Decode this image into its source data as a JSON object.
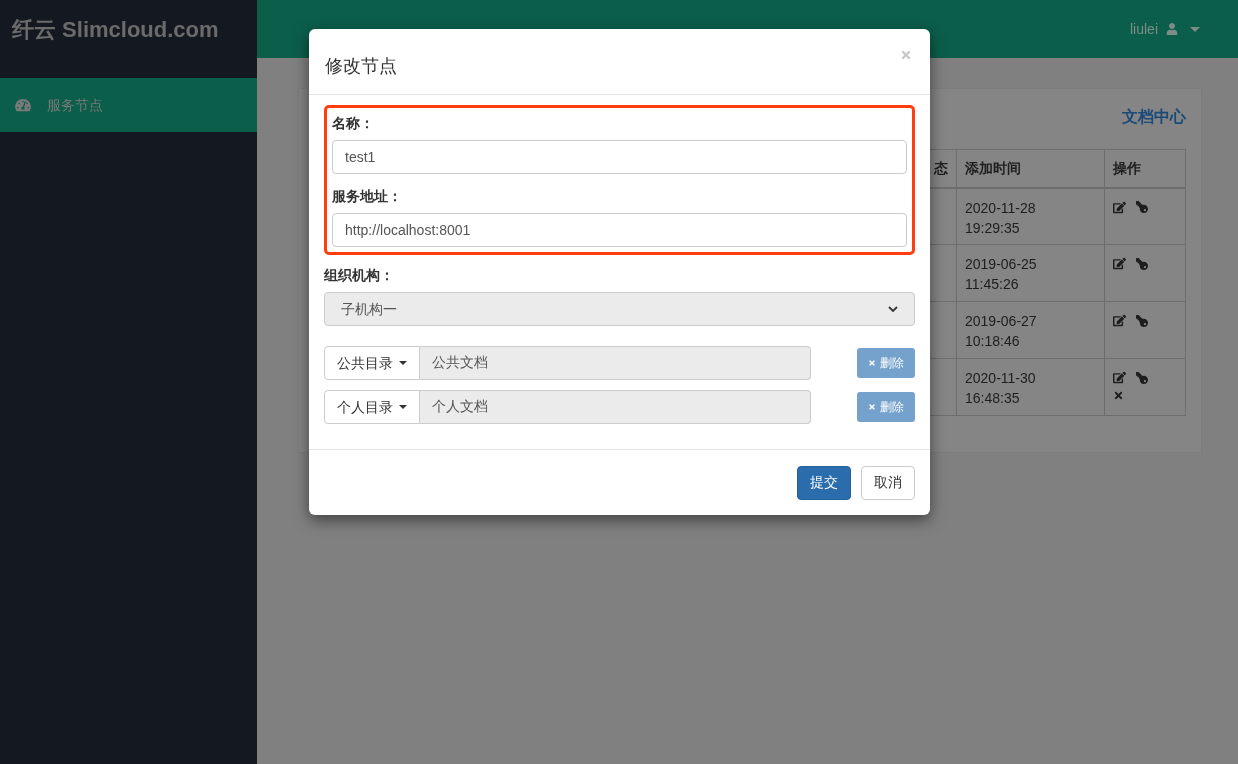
{
  "brand": "纤云 Slimcloud.com",
  "sidebar": {
    "items": [
      {
        "label": "服务节点",
        "selected": true
      }
    ]
  },
  "topbar": {
    "user": "liulei"
  },
  "panel": {
    "link": "文档中心",
    "table": {
      "columns": [
        "态",
        "添加时间",
        "操作"
      ],
      "rows": [
        {
          "time": [
            "2020-11-28",
            "19:29:35"
          ],
          "deletable": false
        },
        {
          "time": [
            "2019-06-25",
            "11:45:26"
          ],
          "deletable": false
        },
        {
          "time": [
            "2019-06-27",
            "10:18:46"
          ],
          "deletable": false
        },
        {
          "time": [
            "2020-11-30",
            "16:48:35"
          ],
          "deletable": true
        }
      ]
    }
  },
  "dialog": {
    "title": "修改节点",
    "fields": [
      {
        "label": "名称：",
        "value": "test1"
      },
      {
        "label": "服务地址：",
        "value": "http://localhost:8001"
      }
    ],
    "org": {
      "label": "组织机构：",
      "value": "子机构一"
    },
    "dirs": [
      {
        "type": "公共目录",
        "value": "公共文档",
        "button": "删除"
      },
      {
        "type": "个人目录",
        "value": "个人文档",
        "button": "删除"
      }
    ],
    "submit": "提交",
    "cancel": "取消"
  }
}
